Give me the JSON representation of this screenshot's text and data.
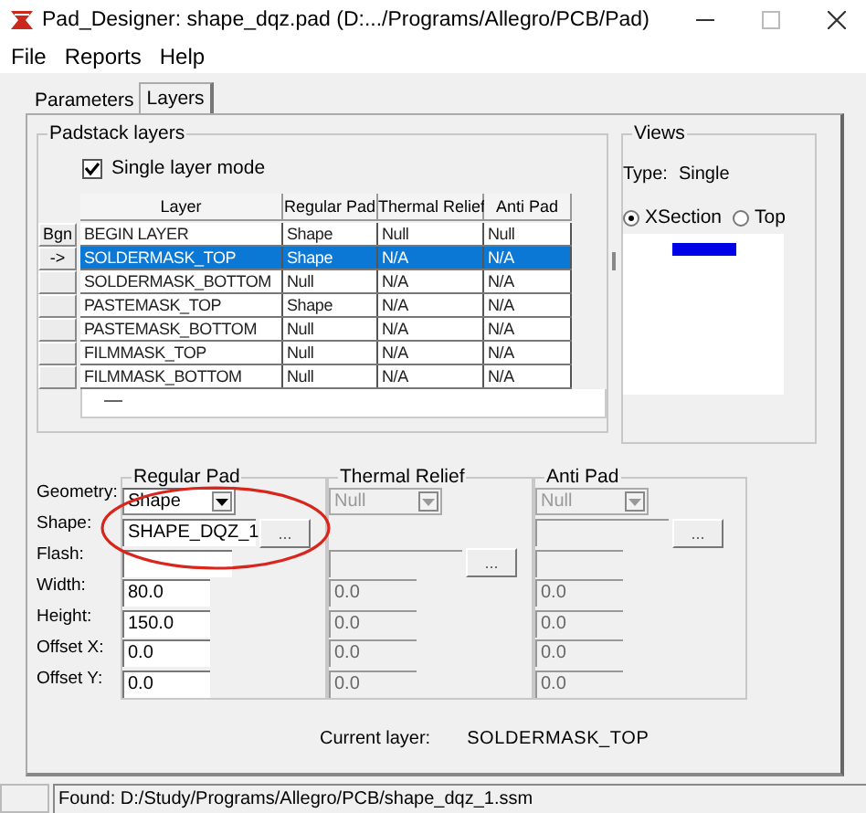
{
  "window": {
    "title": "Pad_Designer: shape_dqz.pad (D:.../Programs/Allegro/PCB/Pad)"
  },
  "menu": [
    "File",
    "Reports",
    "Help"
  ],
  "tabs": [
    {
      "label": "Parameters",
      "selected": false
    },
    {
      "label": "Layers",
      "selected": true
    }
  ],
  "padstack_layers": {
    "title": "Padstack layers",
    "single_layer_mode": {
      "label": "Single layer mode",
      "checked": true
    },
    "columns": [
      "Layer",
      "Regular Pad",
      "Thermal Relief",
      "Anti Pad"
    ],
    "rows": [
      {
        "marker": "Bgn",
        "cells": [
          "BEGIN LAYER",
          "Shape",
          "Null",
          "Null"
        ],
        "selected": false
      },
      {
        "marker": "->",
        "cells": [
          "SOLDERMASK_TOP",
          "Shape",
          "N/A",
          "N/A"
        ],
        "selected": true
      },
      {
        "cells": [
          "SOLDERMASK_BOTTOM",
          "Null",
          "N/A",
          "N/A"
        ],
        "selected": false
      },
      {
        "cells": [
          "PASTEMASK_TOP",
          "Shape",
          "N/A",
          "N/A"
        ],
        "selected": false
      },
      {
        "cells": [
          "PASTEMASK_BOTTOM",
          "Null",
          "N/A",
          "N/A"
        ],
        "selected": false
      },
      {
        "cells": [
          "FILMMASK_TOP",
          "Null",
          "N/A",
          "N/A"
        ],
        "selected": false
      },
      {
        "cells": [
          "FILMMASK_BOTTOM",
          "Null",
          "N/A",
          "N/A"
        ],
        "selected": false
      }
    ]
  },
  "views": {
    "title": "Views",
    "type_label": "Type:",
    "type_value": "Single",
    "options": [
      {
        "label": "XSection",
        "selected": true
      },
      {
        "label": "Top",
        "selected": false
      }
    ]
  },
  "field_labels": [
    "Geometry:",
    "Shape:",
    "Flash:",
    "Width:",
    "Height:",
    "Offset X:",
    "Offset Y:"
  ],
  "pad_groups": [
    {
      "title": "Regular Pad",
      "disabled": false,
      "fields": [
        {
          "kind": "dropdown",
          "value": "Shape"
        },
        {
          "kind": "browse",
          "value": "SHAPE_DQZ_1",
          "button": "..."
        },
        {
          "kind": "text"
        },
        {
          "kind": "text",
          "value": "80.0"
        },
        {
          "kind": "text",
          "value": "150.0"
        },
        {
          "kind": "text",
          "value": "0.0"
        },
        {
          "kind": "text",
          "value": "0.0"
        }
      ]
    },
    {
      "title": "Thermal Relief",
      "disabled": true,
      "fields": [
        {
          "kind": "dropdown",
          "value": "Null"
        },
        {
          "kind": "blank"
        },
        {
          "kind": "browse",
          "button": "..."
        },
        {
          "kind": "text",
          "value": "0.0"
        },
        {
          "kind": "text",
          "value": "0.0"
        },
        {
          "kind": "text",
          "value": "0.0"
        },
        {
          "kind": "text",
          "value": "0.0"
        }
      ]
    },
    {
      "title": "Anti Pad",
      "disabled": true,
      "fields": [
        {
          "kind": "dropdown",
          "value": "Null"
        },
        {
          "kind": "browse",
          "button": "..."
        },
        {
          "kind": "text"
        },
        {
          "kind": "text",
          "value": "0.0"
        },
        {
          "kind": "text",
          "value": "0.0"
        },
        {
          "kind": "text",
          "value": "0.0"
        },
        {
          "kind": "text",
          "value": "0.0"
        }
      ]
    }
  ],
  "current_layer": {
    "label": "Current layer:",
    "value": "SOLDERMASK_TOP"
  },
  "status_bar": {
    "text": "Found: D:/Study/Programs/Allegro/PCB/shape_dqz_1.ssm"
  }
}
